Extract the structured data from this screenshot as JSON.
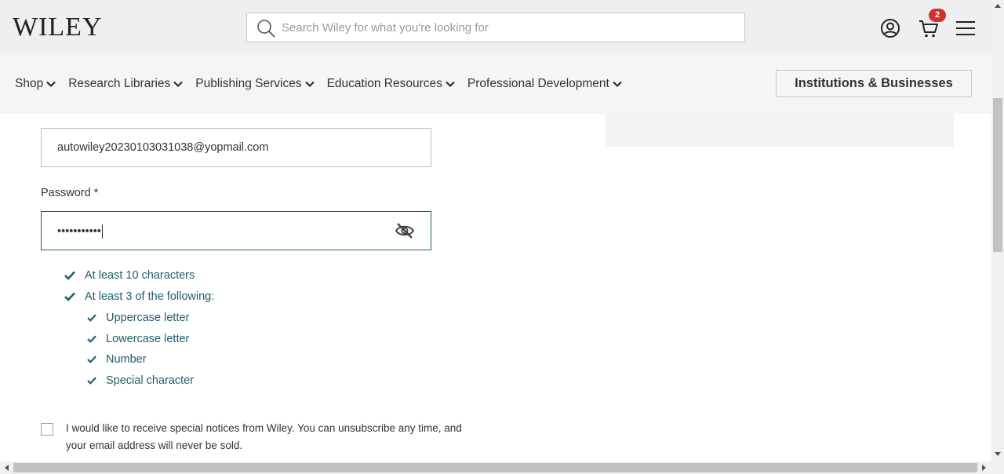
{
  "header": {
    "logo": "WILEY",
    "search_placeholder": "Search Wiley for what you're looking for",
    "cart_count": "2",
    "icons": [
      "search-icon",
      "account-icon",
      "cart-icon",
      "menu-icon"
    ]
  },
  "nav": {
    "items": [
      {
        "label": "Shop"
      },
      {
        "label": "Research Libraries"
      },
      {
        "label": "Publishing Services"
      },
      {
        "label": "Education Resources"
      },
      {
        "label": "Professional Development"
      }
    ],
    "institutions_label": "Institutions & Businesses"
  },
  "form": {
    "email_value": "autowiley20230103031038@yopmail.com",
    "password_label": "Password *",
    "password_value": "•••••••••••",
    "rules": {
      "min_chars": "At least 10 characters",
      "three_of": "At least 3 of the following:",
      "uppercase": "Uppercase letter",
      "lowercase": "Lowercase letter",
      "number": "Number",
      "special": "Special character"
    },
    "optin_text": "I would like to receive special notices from Wiley. You can unsubscribe any time, and your email address will never be sold."
  },
  "colors": {
    "accent": "#1d5d6d",
    "badge": "#d32f2f",
    "header_bg": "#efefef",
    "nav_bg": "#f5f5f5"
  }
}
